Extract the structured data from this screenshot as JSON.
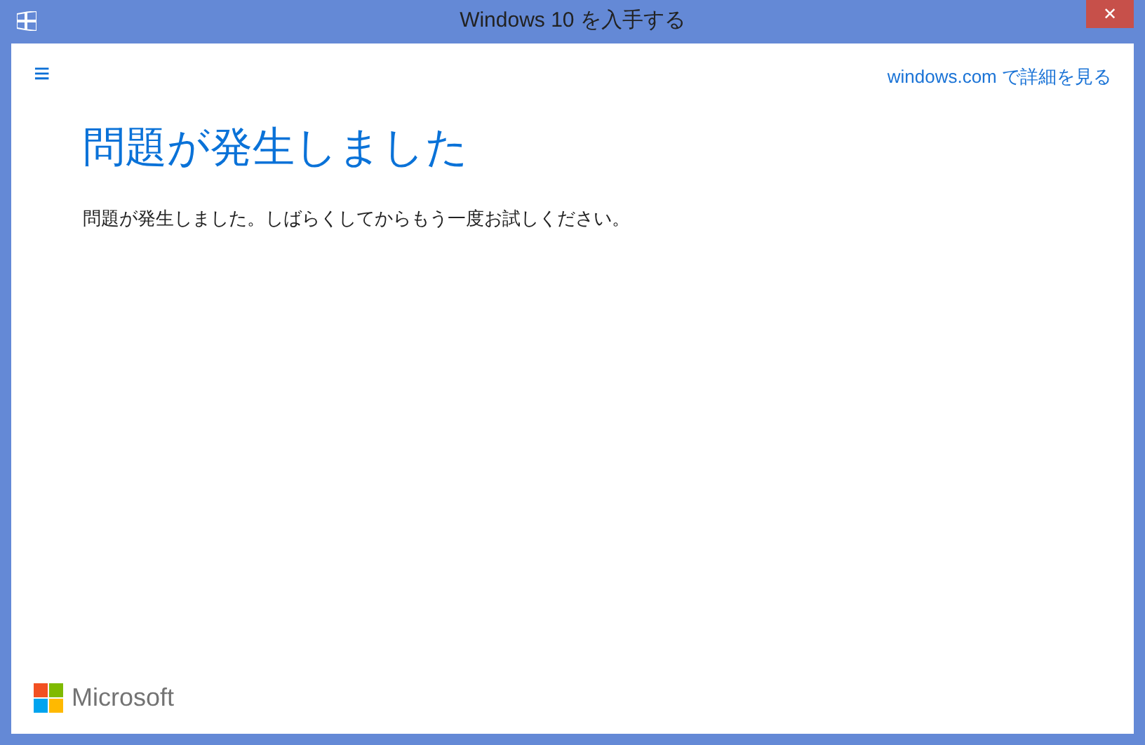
{
  "window": {
    "title": "Windows 10 を入手する",
    "close": "✕"
  },
  "header": {
    "menu": "≡",
    "link": "windows.com で詳細を見る"
  },
  "content": {
    "heading": "問題が発生しました",
    "message": "問題が発生しました。しばらくしてからもう一度お試しください。"
  },
  "footer": {
    "brand": "Microsoft"
  }
}
